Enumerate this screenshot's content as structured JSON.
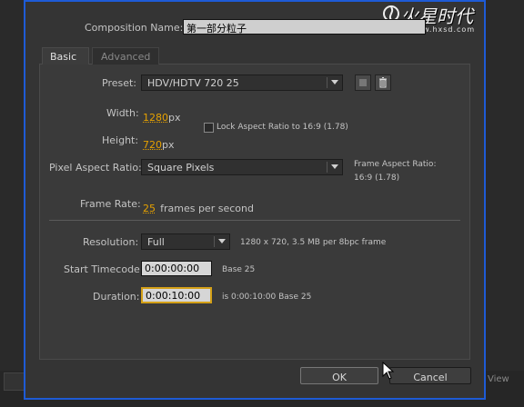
{
  "watermark": {
    "text": "火星时代",
    "url": "www.hxsd.com"
  },
  "composition": {
    "label": "Composition Name:",
    "value": "第一部分粒子"
  },
  "tabs": [
    {
      "label": "Basic",
      "active": true
    },
    {
      "label": "Advanced",
      "active": false
    }
  ],
  "preset": {
    "label": "Preset:",
    "value": "HDV/HDTV 720 25"
  },
  "width": {
    "label": "Width:",
    "value": "1280",
    "unit": "px"
  },
  "height": {
    "label": "Height:",
    "value": "720",
    "unit": "px"
  },
  "lock_aspect": {
    "label": "Lock Aspect Ratio to 16:9 (1.78)",
    "checked": false
  },
  "pixel_aspect": {
    "label": "Pixel Aspect Ratio:",
    "value": "Square Pixels"
  },
  "frame_aspect": {
    "label": "Frame Aspect Ratio:",
    "value": "16:9 (1.78)"
  },
  "frame_rate": {
    "label": "Frame Rate:",
    "value": "25",
    "unit": "frames per second"
  },
  "resolution": {
    "label": "Resolution:",
    "value": "Full",
    "info": "1280 x 720, 3.5 MB per 8bpc frame"
  },
  "start_timecode": {
    "label": "Start Timecode:",
    "value": "0:00:00:00",
    "info": "Base 25"
  },
  "duration": {
    "label": "Duration:",
    "value": "0:00:10:00",
    "info": "is 0:00:10:00  Base 25"
  },
  "buttons": {
    "ok": "OK",
    "cancel": "Cancel"
  },
  "footer": {
    "view_label": "View"
  },
  "colors": {
    "accent_value": "#e6a100",
    "dialog_border": "#1e5bd6",
    "focus_border": "#d4a017"
  }
}
